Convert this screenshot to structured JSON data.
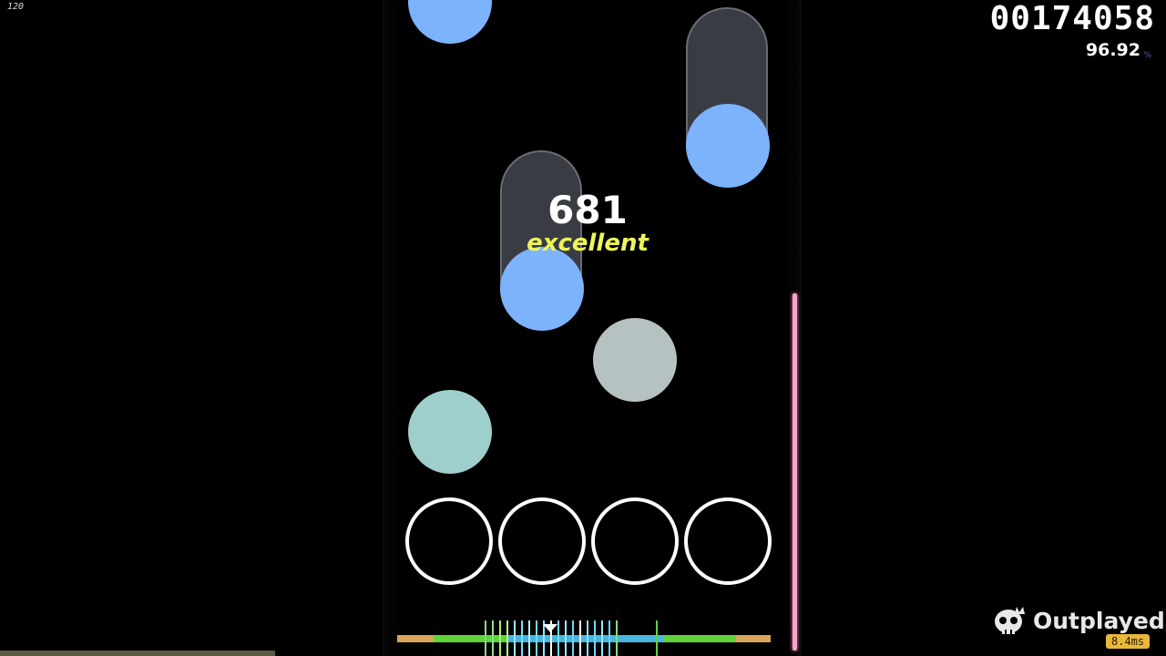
{
  "hud": {
    "fps": "120",
    "score": "00174058",
    "accuracy": "96.92",
    "accuracy_suffix": "%"
  },
  "judgement": {
    "combo": "681",
    "label": "excellent"
  },
  "overlay": {
    "brand": "Outplayed",
    "latency": "8.4ms"
  },
  "colors": {
    "note_blue": "#7db3fc",
    "note_gray": "#b6c2c2",
    "note_teal": "#9fcfcd",
    "judge_yellow": "#ecf55a",
    "hp_pink": "#f2a6c6"
  },
  "icons": {
    "brand": "skull-crown-icon"
  }
}
